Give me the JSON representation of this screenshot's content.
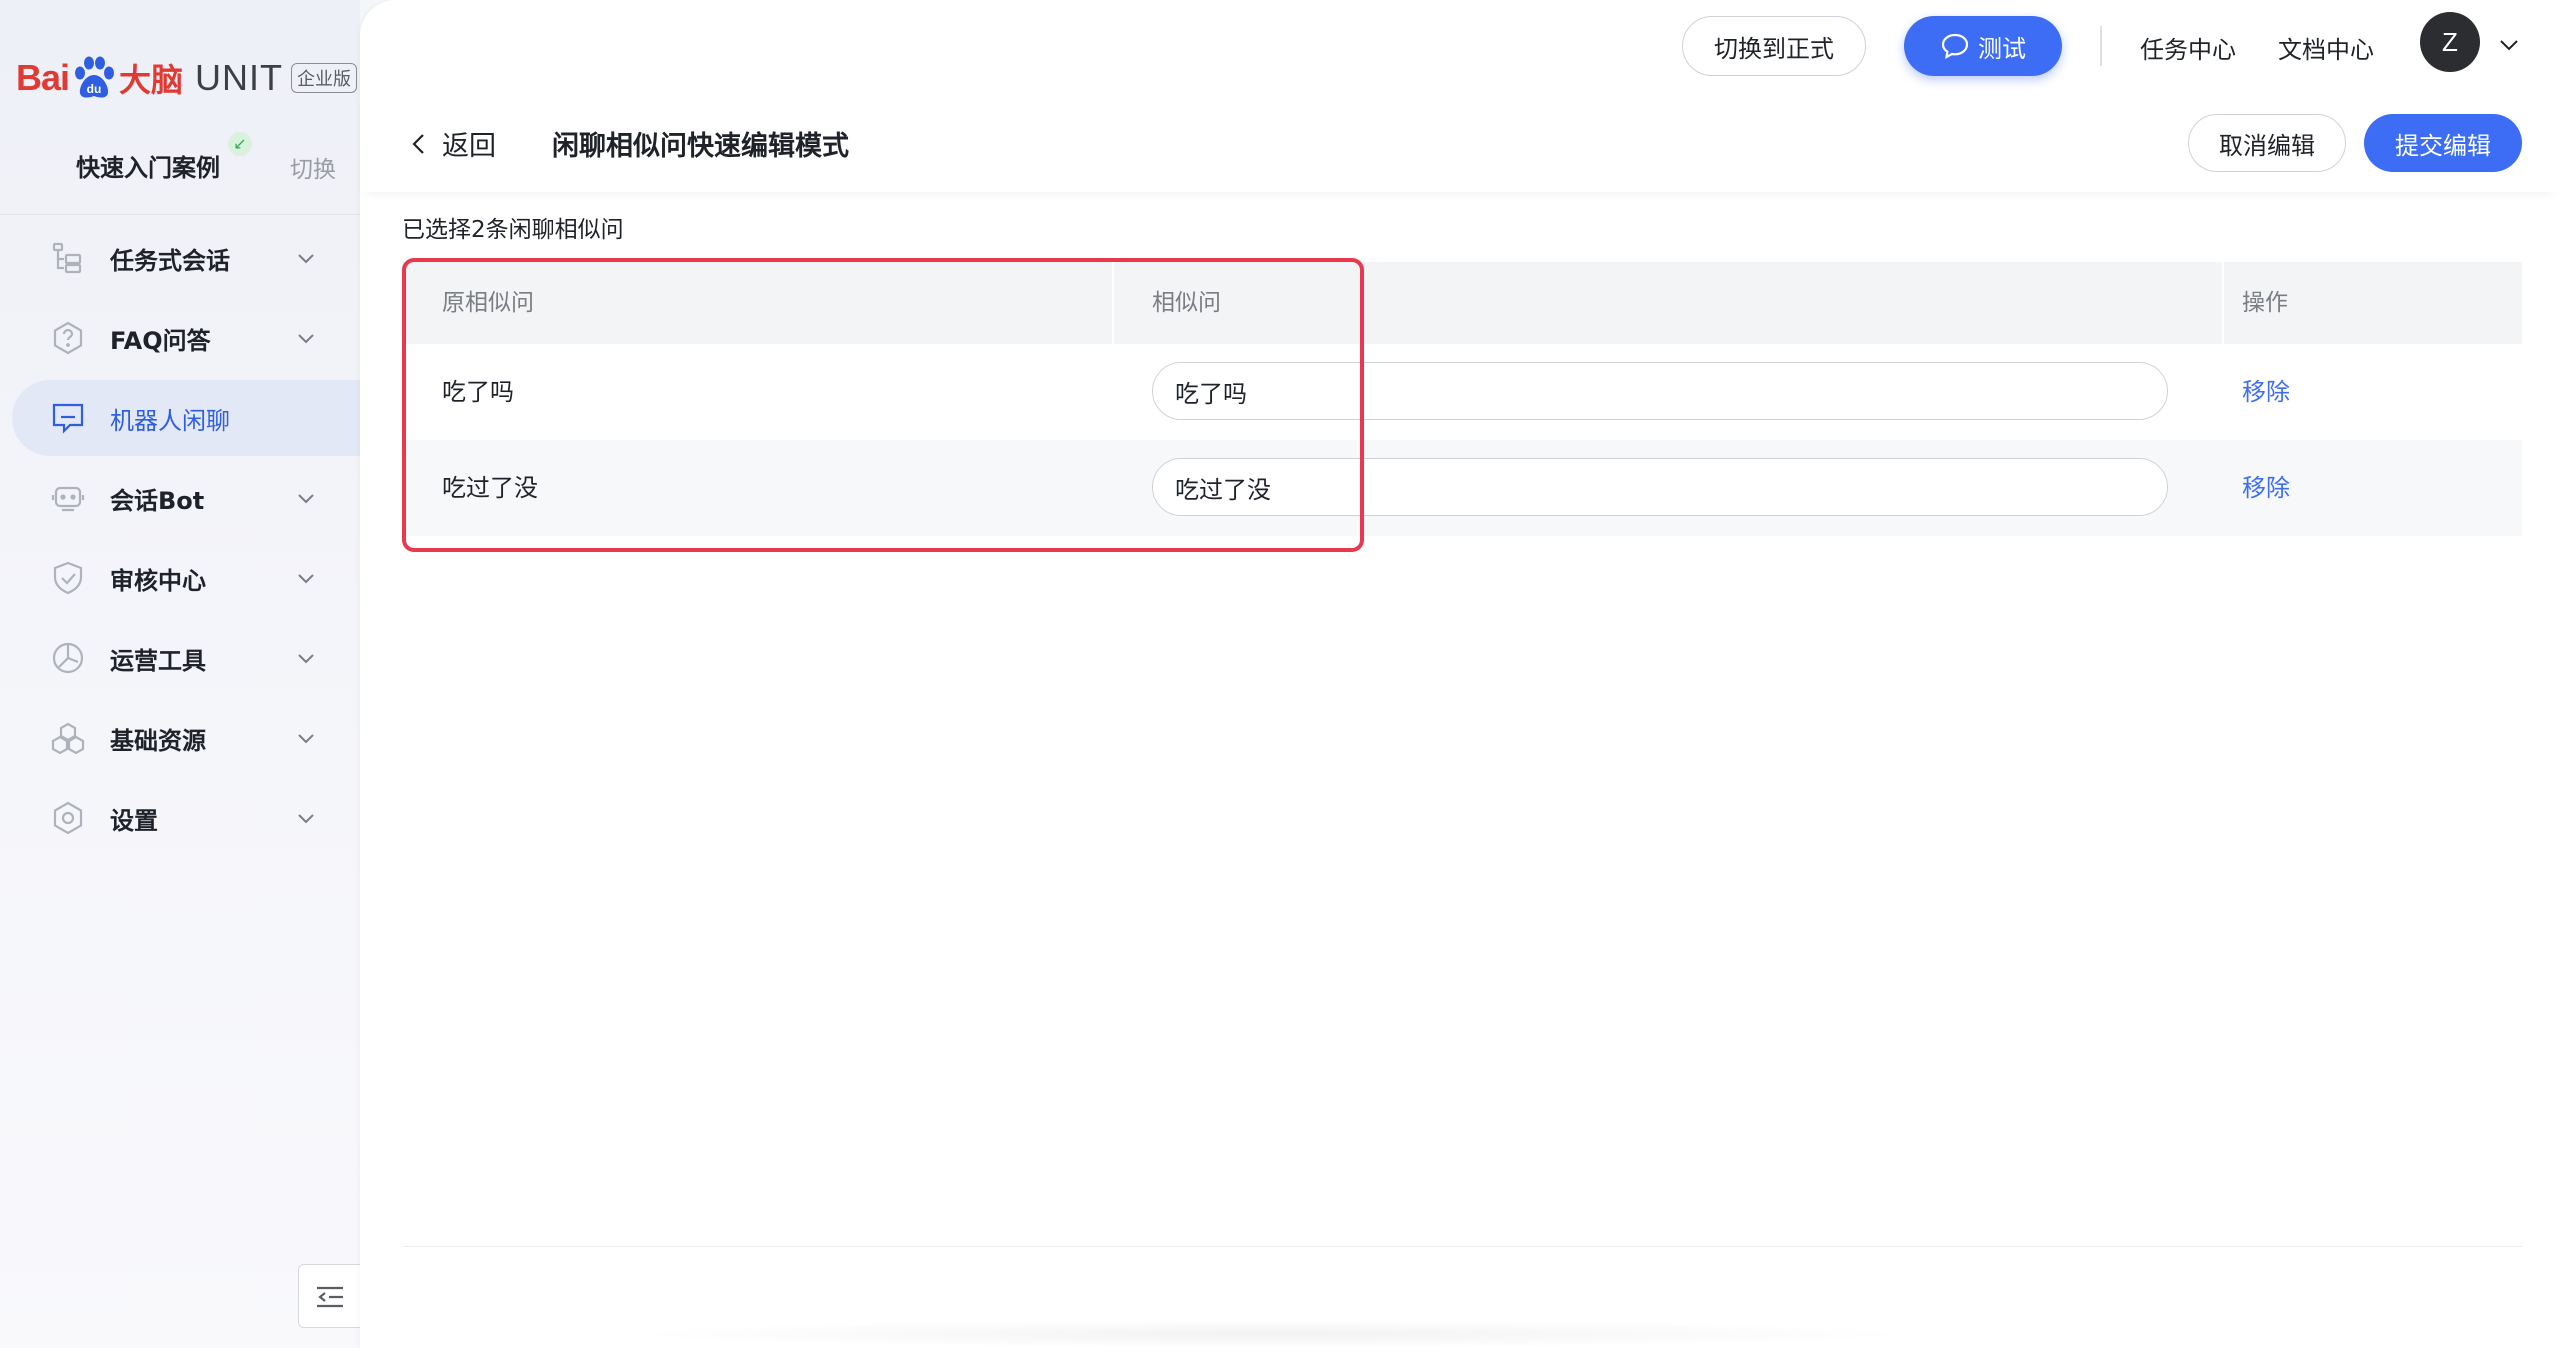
{
  "brand": {
    "bai": "Bai",
    "du": "du",
    "brain": "大脑",
    "unit": "UNIT",
    "edition": "企业版"
  },
  "project": {
    "name": "快速入门案例",
    "switch_label": "切换"
  },
  "sidebar": {
    "items": [
      {
        "label": "任务式会话",
        "icon": "task-flow-icon",
        "expandable": true
      },
      {
        "label": "FAQ问答",
        "icon": "faq-question-icon",
        "expandable": true
      },
      {
        "label": "机器人闲聊",
        "icon": "chat-bubble-icon",
        "expandable": false,
        "active": true
      },
      {
        "label": "会话Bot",
        "icon": "bot-icon",
        "expandable": true
      },
      {
        "label": "审核中心",
        "icon": "shield-check-icon",
        "expandable": true
      },
      {
        "label": "运营工具",
        "icon": "operations-icon",
        "expandable": true
      },
      {
        "label": "基础资源",
        "icon": "resources-icon",
        "expandable": true
      },
      {
        "label": "设置",
        "icon": "settings-icon",
        "expandable": true
      }
    ]
  },
  "topbar": {
    "switch_label": "切换到正式",
    "test_label": "测试",
    "task_center": "任务中心",
    "doc_center": "文档中心",
    "avatar_initial": "Z"
  },
  "page": {
    "back_label": "返回",
    "title": "闲聊相似问快速编辑模式",
    "cancel_label": "取消编辑",
    "submit_label": "提交编辑",
    "selection_info": "已选择2条闲聊相似问"
  },
  "table": {
    "headers": {
      "original": "原相似问",
      "similar": "相似问",
      "action": "操作"
    },
    "rows": [
      {
        "original": "吃了吗",
        "similar": "吃了吗",
        "action": "移除"
      },
      {
        "original": "吃过了没",
        "similar": "吃过了没",
        "action": "移除"
      }
    ]
  },
  "colors": {
    "primary": "#3d6df5",
    "highlight": "#e8394f",
    "brand_red": "#e03a34"
  }
}
